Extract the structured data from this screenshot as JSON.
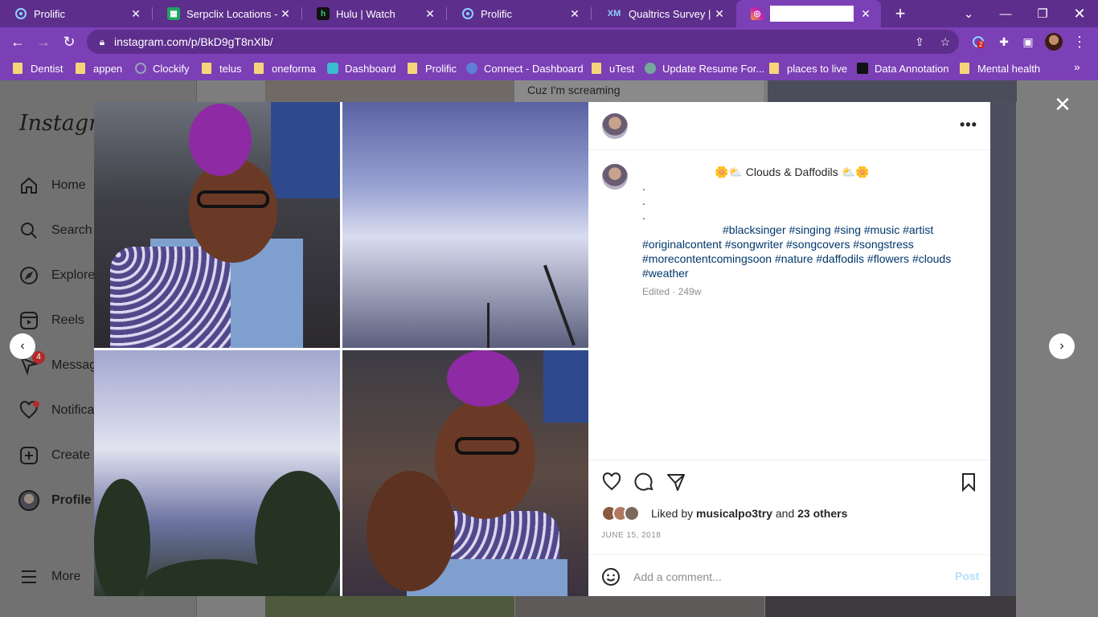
{
  "tabs": [
    {
      "title": "Prolific",
      "icon": "prolific-icon"
    },
    {
      "title": "Serpclix Locations - Go",
      "icon": "sheets-icon"
    },
    {
      "title": "Hulu | Watch",
      "icon": "hulu-icon"
    },
    {
      "title": "Prolific",
      "icon": "prolific-icon"
    },
    {
      "title": "Qualtrics Survey | Qua",
      "icon": "qualtrics-icon"
    },
    {
      "title": "",
      "icon": "instagram-icon"
    }
  ],
  "address": {
    "url": "instagram.com/p/BkD9gT8nXlb/"
  },
  "extensions": {
    "badge": "2"
  },
  "bookmarks": [
    {
      "label": "Dentist",
      "type": "folder"
    },
    {
      "label": "appen",
      "type": "folder"
    },
    {
      "label": "Clockify",
      "type": "site"
    },
    {
      "label": "telus",
      "type": "folder"
    },
    {
      "label": "oneforma",
      "type": "folder"
    },
    {
      "label": "Dashboard",
      "type": "site"
    },
    {
      "label": "Prolific",
      "type": "folder"
    },
    {
      "label": "Connect - Dashboard",
      "type": "site"
    },
    {
      "label": "uTest",
      "type": "folder"
    },
    {
      "label": "Update Resume For...",
      "type": "site"
    },
    {
      "label": "places to live",
      "type": "folder"
    },
    {
      "label": "Data Annotation",
      "type": "site"
    },
    {
      "label": "Mental health",
      "type": "folder"
    }
  ],
  "instagram": {
    "logo": "Instagram",
    "nav": [
      {
        "label": "Home",
        "icon": "home-icon"
      },
      {
        "label": "Search",
        "icon": "search-icon"
      },
      {
        "label": "Explore",
        "icon": "explore-icon"
      },
      {
        "label": "Reels",
        "icon": "reels-icon"
      },
      {
        "label": "Messages",
        "icon": "messages-icon",
        "badge": "4"
      },
      {
        "label": "Notifications",
        "icon": "heart-icon"
      },
      {
        "label": "Create",
        "icon": "create-icon"
      },
      {
        "label": "Profile",
        "icon": "profile-icon"
      },
      {
        "label": "More",
        "icon": "menu-icon"
      }
    ],
    "feed_text": "Cuz I'm screaming"
  },
  "post": {
    "caption_title": "🌼⛅ Clouds & Daffodils ⛅🌼",
    "dots": [
      ".",
      ".",
      "."
    ],
    "hashtags_line1": "#blacksinger #singing #sing #music #artist",
    "hashtags_rest": "#originalcontent #songwriter #songcovers #songstress #morecontentcomingsoon #nature #daffodils #flowers #clouds #weather",
    "meta": "Edited · 249w",
    "liked_prefix": "Liked by ",
    "liked_user": "musicalpo3try",
    "liked_mid": " and ",
    "liked_others": "23 others",
    "date": "JUNE 15, 2018",
    "comment_placeholder": "Add a comment...",
    "post_label": "Post"
  },
  "colors": {
    "chrome_dark": "#5d2e8c",
    "chrome_light": "#7b3fb6",
    "hashtag": "#00376b",
    "post_button": "#b2dffc"
  }
}
